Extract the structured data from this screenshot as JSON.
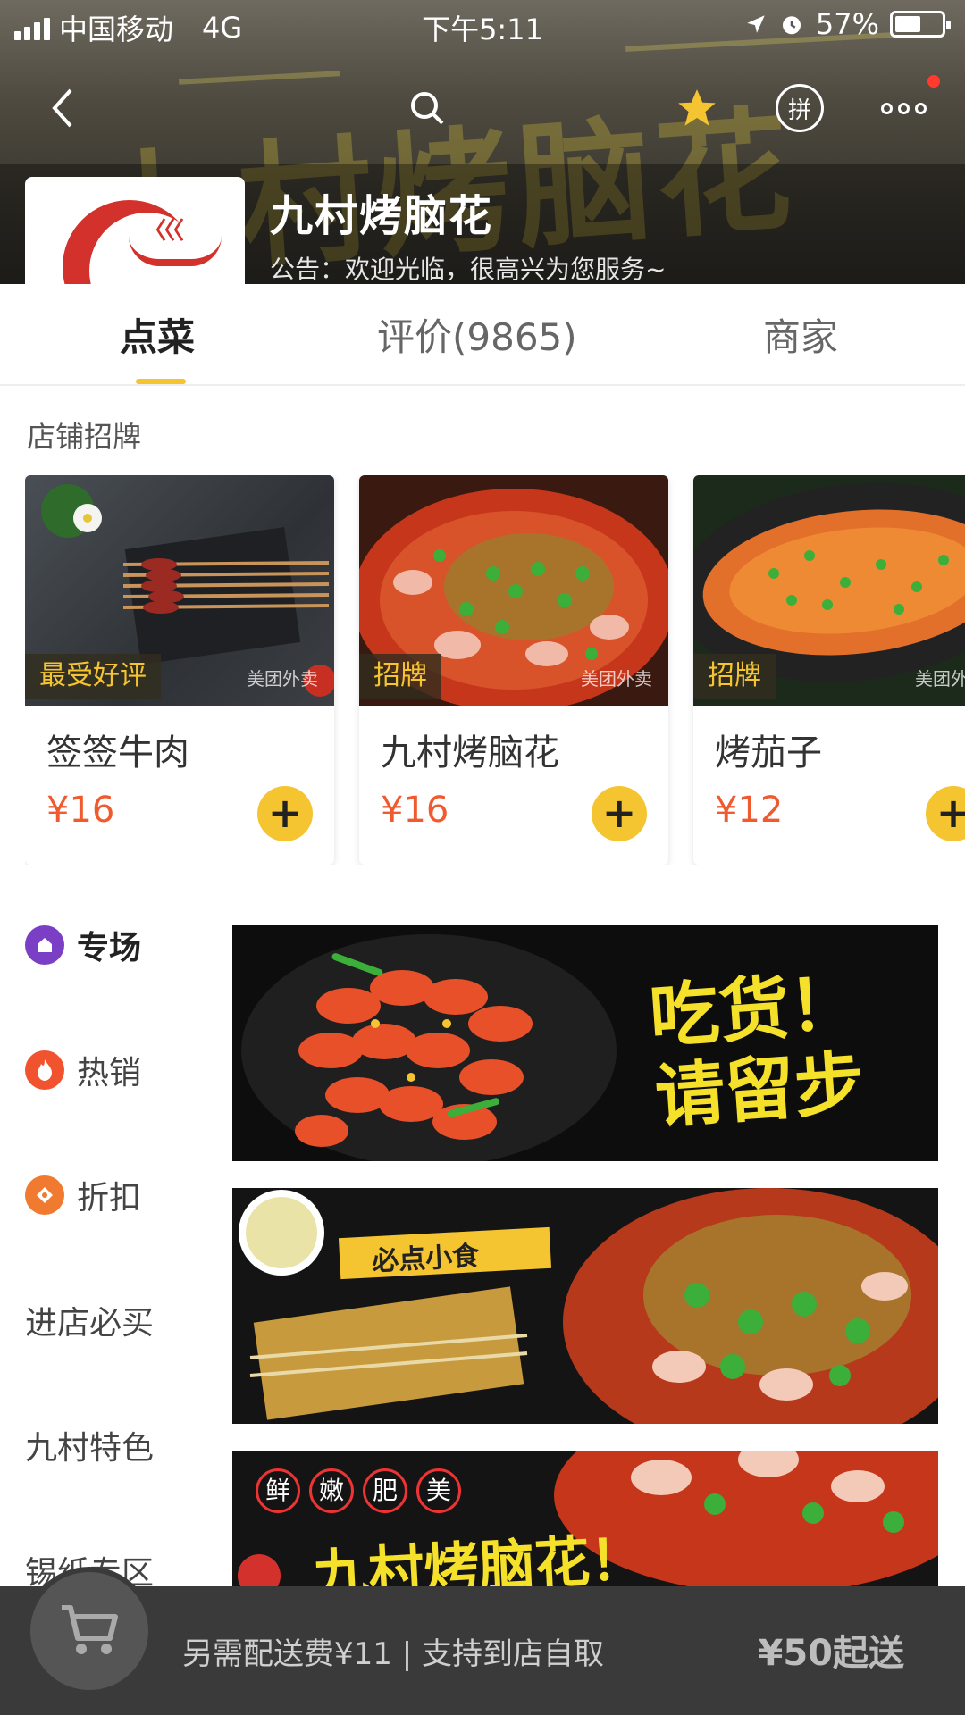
{
  "status_bar": {
    "carrier": "中国移动",
    "network": "4G",
    "time": "下午5:11",
    "battery": "57%",
    "battery_level": 0.57
  },
  "header": {
    "store_name": "九村烤脑花",
    "notice": "公告：欢迎光临，很高兴为您服务~",
    "pin_label": "拼"
  },
  "tabs": [
    {
      "label": "点菜",
      "active": true
    },
    {
      "label": "评价(9865)",
      "active": false
    },
    {
      "label": "商家",
      "active": false
    }
  ],
  "signature": {
    "title": "店铺招牌",
    "items": [
      {
        "badge": "最受好评",
        "name": "签签牛肉",
        "price": "¥16",
        "watermark": "美团外卖"
      },
      {
        "badge": "招牌",
        "name": "九村烤脑花",
        "price": "¥16",
        "watermark": "美团外卖"
      },
      {
        "badge": "招牌",
        "name": "烤茄子",
        "price": "¥12",
        "watermark": "美团外卖"
      }
    ]
  },
  "sidebar": {
    "items": [
      {
        "label": "专场",
        "icon": "bag-icon",
        "color": "#7a3fc4"
      },
      {
        "label": "热销",
        "icon": "flame-icon",
        "color": "#f0532e"
      },
      {
        "label": "折扣",
        "icon": "discount-tag-icon",
        "color": "#f07a30"
      },
      {
        "label": "进店必买"
      },
      {
        "label": "九村特色"
      },
      {
        "label": "锡纸专区"
      }
    ]
  },
  "banners": [
    {
      "text": "吃货！请留步"
    },
    {
      "text": "必点小食"
    },
    {
      "tags": [
        "鲜",
        "嫩",
        "肥",
        "美"
      ],
      "text": "九村烤脑花！"
    }
  ],
  "bottom_bar": {
    "fee_text": "另需配送费¥11 | 支持到店自取",
    "min_order": "¥50起送"
  },
  "colors": {
    "accent": "#f5c431",
    "price": "#ef5a2f",
    "bottom_bar": "#3a3a3a"
  }
}
